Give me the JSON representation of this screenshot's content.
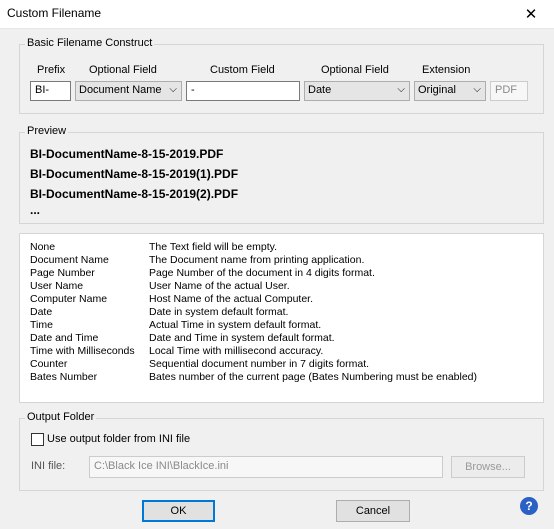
{
  "window": {
    "title": "Custom Filename",
    "close_glyph": "✕"
  },
  "construct": {
    "group_label": "Basic Filename Construct",
    "prefix": {
      "label": "Prefix",
      "value": "BI-"
    },
    "optional1": {
      "label": "Optional Field",
      "value": "Document Name"
    },
    "custom": {
      "label": "Custom Field",
      "value": "-"
    },
    "optional2": {
      "label": "Optional Field",
      "value": "Date"
    },
    "extension": {
      "label": "Extension",
      "value": "Original",
      "ext_text": "PDF"
    },
    "chevron": "⌵"
  },
  "preview": {
    "group_label": "Preview",
    "lines": [
      "BI-DocumentName-8-15-2019.PDF",
      "BI-DocumentName-8-15-2019(1).PDF",
      "BI-DocumentName-8-15-2019(2).PDF",
      "..."
    ]
  },
  "descriptions": [
    {
      "key": "None",
      "value": "The Text field will be empty."
    },
    {
      "key": "Document Name",
      "value": "The Document name from printing application."
    },
    {
      "key": "Page Number",
      "value": "Page Number of the document in 4 digits format."
    },
    {
      "key": "User Name",
      "value": "User Name of the actual User."
    },
    {
      "key": "Computer Name",
      "value": "Host Name of the actual Computer."
    },
    {
      "key": "Date",
      "value": "Date in system default format."
    },
    {
      "key": "Time",
      "value": "Actual Time in system default format."
    },
    {
      "key": "Date and Time",
      "value": "Date and Time in system default format."
    },
    {
      "key": "Time with Milliseconds",
      "value": "Local Time with millisecond accuracy."
    },
    {
      "key": "Counter",
      "value": "Sequential document number in 7 digits format."
    },
    {
      "key": "Bates Number",
      "value": "Bates number of the current page (Bates Numbering must be enabled)"
    }
  ],
  "output": {
    "group_label": "Output Folder",
    "checkbox_label": "Use output folder from INI file",
    "ini_label": "INI file:",
    "ini_value": "C:\\Black Ice INI\\BlackIce.ini",
    "browse_label": "Browse..."
  },
  "buttons": {
    "ok": "OK",
    "cancel": "Cancel"
  },
  "help_glyph": "?"
}
